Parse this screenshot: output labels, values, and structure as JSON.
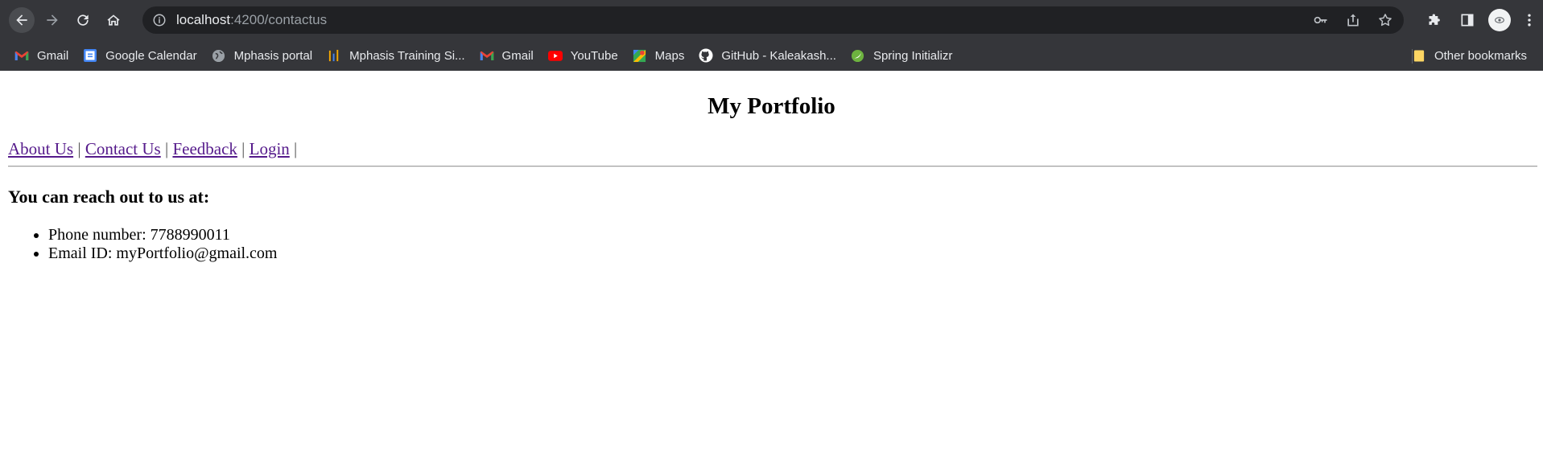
{
  "browser": {
    "url_host": "localhost",
    "url_path": ":4200/contactus",
    "bookmarks": [
      {
        "label": "Gmail",
        "icon": "gmail-icon"
      },
      {
        "label": "Google Calendar",
        "icon": "calendar-icon"
      },
      {
        "label": "Mphasis portal",
        "icon": "globe-icon"
      },
      {
        "label": "Mphasis Training Si...",
        "icon": "bars-icon"
      },
      {
        "label": "Gmail",
        "icon": "gmail-icon"
      },
      {
        "label": "YouTube",
        "icon": "youtube-icon"
      },
      {
        "label": "Maps",
        "icon": "maps-icon"
      },
      {
        "label": "GitHub - Kaleakash...",
        "icon": "github-icon"
      },
      {
        "label": "Spring Initializr",
        "icon": "spring-icon"
      }
    ],
    "other_bookmarks": "Other bookmarks"
  },
  "page": {
    "title": "My Portfolio",
    "nav": [
      {
        "label": "About Us"
      },
      {
        "label": "Contact Us"
      },
      {
        "label": "Feedback"
      },
      {
        "label": "Login"
      }
    ],
    "nav_separator": "|",
    "heading": "You can reach out to us at:",
    "contacts": [
      "Phone number: 7788990011",
      "Email ID: myPortfolio@gmail.com"
    ]
  },
  "colors": {
    "chrome_bg": "#35363a",
    "omnibox_bg": "#202124",
    "visited_link": "#551a8b"
  }
}
